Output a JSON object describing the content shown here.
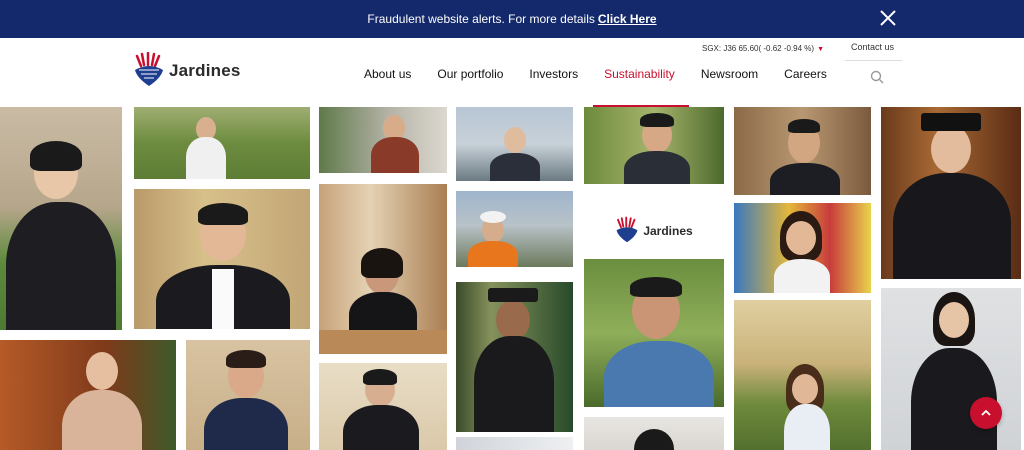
{
  "alert": {
    "message": "Fraudulent website alerts. For more details",
    "link_label": "Click Here"
  },
  "header": {
    "brand": "Jardines",
    "ticker": "SGX: J36 65.60( -0.62 -0.94 %)",
    "contact_label": "Contact us",
    "nav": [
      {
        "label": "About us"
      },
      {
        "label": "Our portfolio"
      },
      {
        "label": "Investors"
      },
      {
        "label": "Sustainability"
      },
      {
        "label": "Newsroom"
      },
      {
        "label": "Careers"
      }
    ],
    "active_nav": "Sustainability"
  },
  "mosaic": {
    "logo_tile_label": "Jardines"
  },
  "colors": {
    "alert_bg": "#14296b",
    "accent": "#c8102e",
    "brand_blue": "#1e3f8f"
  },
  "icons": {
    "close": "close-icon",
    "search": "search-icon",
    "scroll_top": "chevron-up-icon",
    "logo": "thistle-logo-icon"
  }
}
